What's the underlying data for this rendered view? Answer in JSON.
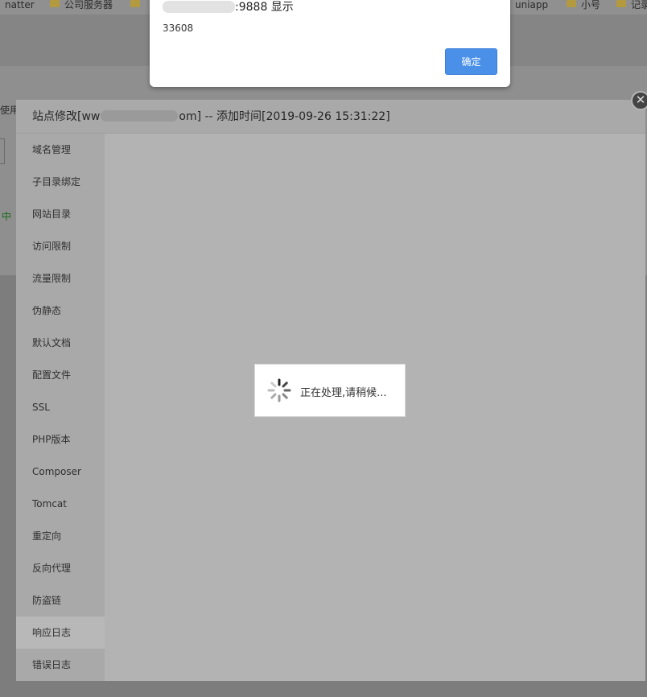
{
  "bookmarks": [
    {
      "label": "natter",
      "icon": "folder-icon"
    },
    {
      "label": "公司服务器",
      "icon": "folder-icon"
    },
    {
      "label": "",
      "icon": "folder-icon"
    },
    {
      "label": "uniapp",
      "icon": "folder-icon"
    },
    {
      "label": "小号",
      "icon": "folder-icon"
    },
    {
      "label": "记录",
      "icon": "folder-icon"
    }
  ],
  "background": {
    "left_label_1": "使用",
    "left_label_2": "中"
  },
  "modal": {
    "title_prefix": "站点修改[ww",
    "title_suffix": "om] -- 添加时间[2019-09-26 15:31:22]",
    "close_symbol": "✕",
    "menu": [
      "域名管理",
      "子目录绑定",
      "网站目录",
      "访问限制",
      "流量限制",
      "伪静态",
      "默认文档",
      "配置文件",
      "SSL",
      "PHP版本",
      "Composer",
      "Tomcat",
      "重定向",
      "反向代理",
      "防盗链",
      "响应日志",
      "错误日志"
    ],
    "active_index": 15
  },
  "loading": {
    "text": "正在处理,请稍候..."
  },
  "alert": {
    "title_suffix": ":9888 显示",
    "message": "33608",
    "ok_label": "确定"
  },
  "colors": {
    "accent": "#4a90e8",
    "overlay": "#7d7d7d"
  }
}
